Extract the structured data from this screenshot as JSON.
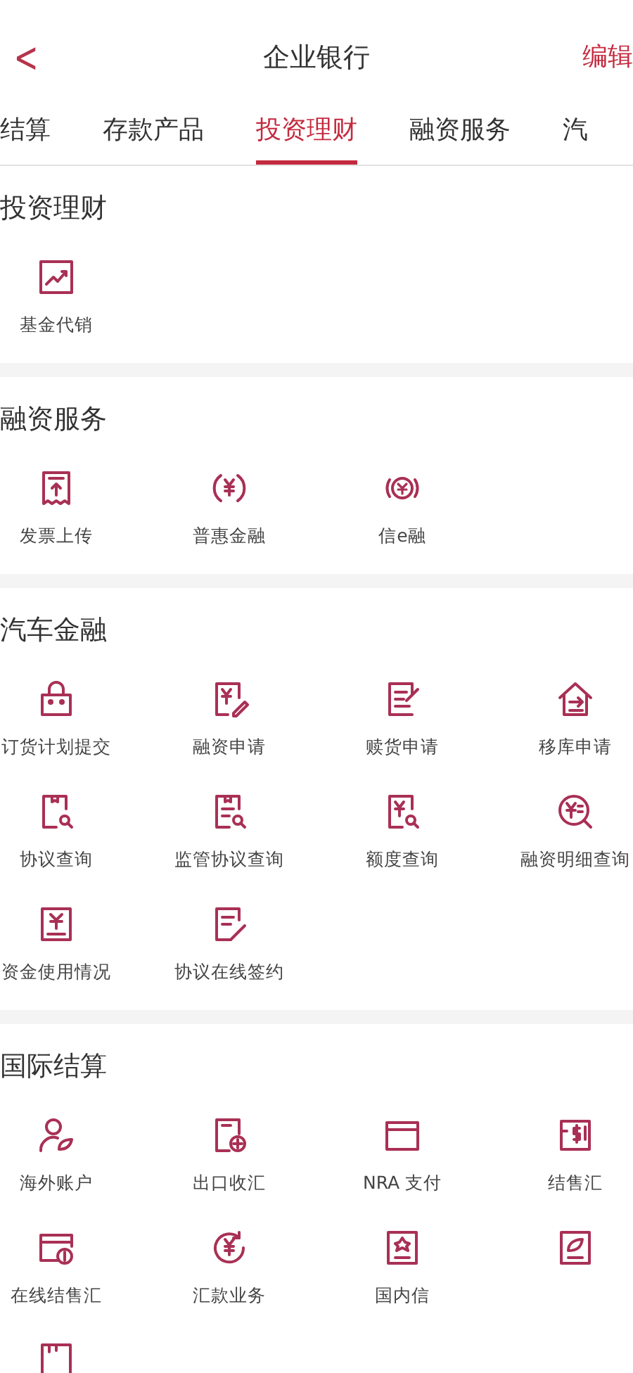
{
  "header": {
    "back": "<",
    "title": "企业银行",
    "action": "编辑"
  },
  "tabs": [
    {
      "label": "结算",
      "selected": false
    },
    {
      "label": "存款产品",
      "selected": false
    },
    {
      "label": "投资理财",
      "selected": true
    },
    {
      "label": "融资服务",
      "selected": false
    },
    {
      "label": "汽",
      "selected": false
    }
  ],
  "sections": [
    {
      "title": "投资理财",
      "items": [
        {
          "kind": "tile",
          "label": "基金代销"
        }
      ]
    },
    {
      "title": "融资服务",
      "items": [
        {
          "kind": "tile",
          "label": "发票上传"
        },
        {
          "kind": "tile",
          "label": "普惠金融"
        },
        {
          "kind": "tile",
          "label": "信e融"
        }
      ]
    },
    {
      "title": "汽车金融",
      "items": [
        {
          "kind": "tile",
          "label": "订货计划提交"
        },
        {
          "kind": "tile",
          "label": "融资申请"
        },
        {
          "kind": "tile",
          "label": "赎货申请"
        },
        {
          "kind": "tile",
          "label": "移库申请"
        },
        {
          "kind": "tile",
          "label": "协议查询"
        },
        {
          "kind": "tile",
          "label": "监管协议查询"
        },
        {
          "kind": "tile",
          "label": "额度查询"
        },
        {
          "kind": "tile",
          "label": "融资明细查询"
        },
        {
          "kind": "tile",
          "label": "资金使用情况"
        },
        {
          "kind": "tile",
          "label": "协议在线签约"
        }
      ]
    },
    {
      "title": "国际结算",
      "items": [
        {
          "kind": "tile",
          "label": "海外账户"
        },
        {
          "kind": "tile",
          "label": "出口收汇"
        },
        {
          "kind": "tile",
          "label": "NRA 支付"
        },
        {
          "kind": "tile",
          "label": "结售汇"
        },
        {
          "kind": "tile",
          "label": "在线结售汇"
        },
        {
          "kind": "tile",
          "label": "汇款业务"
        },
        {
          "kind": "tile",
          "label": "国内信"
        },
        {
          "kind": "icon"
        },
        {
          "kind": "icon"
        }
      ]
    }
  ]
}
